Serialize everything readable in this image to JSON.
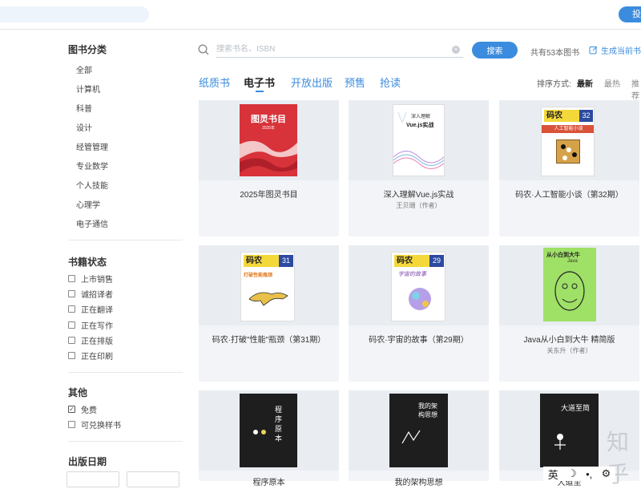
{
  "top": {
    "right_button": "投"
  },
  "sidebar": {
    "category_title": "图书分类",
    "categories": [
      "全部",
      "计算机",
      "科普",
      "设计",
      "经管管理",
      "专业数学",
      "个人技能",
      "心理学",
      "电子通信"
    ],
    "status_title": "书籍状态",
    "statuses": [
      {
        "label": "上市销售",
        "checked": false
      },
      {
        "label": "诚招译者",
        "checked": false
      },
      {
        "label": "正在翻译",
        "checked": false
      },
      {
        "label": "正在写作",
        "checked": false
      },
      {
        "label": "正在排版",
        "checked": false
      },
      {
        "label": "正在印刷",
        "checked": false
      }
    ],
    "other_title": "其他",
    "others": [
      {
        "label": "免费",
        "checked": true
      },
      {
        "label": "可兑换样书",
        "checked": false
      }
    ],
    "date_title": "出版日期"
  },
  "search": {
    "placeholder": "搜索书名、ISBN",
    "button": "搜索",
    "total": "共有53本图书",
    "generate_link": "生成当前书单"
  },
  "tabs": [
    "纸质书",
    "电子书",
    "开放出版",
    "预售",
    "抢读"
  ],
  "active_tab": "电子书",
  "sort": {
    "label": "排序方式:",
    "options": [
      "最新",
      "最热",
      "推荐"
    ],
    "active": "最新"
  },
  "books": [
    {
      "title": "2025年图灵书目",
      "author": "",
      "cover_text": "图灵书目",
      "cover_sub": "2025年"
    },
    {
      "title": "深入理解Vue.js实战",
      "author": "王贝珊（作者）",
      "cover_text": "Vue.js实战",
      "cover_sub": "深入理解"
    },
    {
      "title": "码农·人工智能小谈（第32期）",
      "author": "",
      "cover_text": "码农",
      "cover_num": "32",
      "cover_sub": "人工智能小谈"
    },
    {
      "title": "码农·打破\"性能\"瓶颈（第31期）",
      "author": "",
      "cover_text": "码农",
      "cover_num": "31",
      "cover_sub": "打破性能瓶颈"
    },
    {
      "title": "码农·宇宙的故事（第29期）",
      "author": "",
      "cover_text": "码农",
      "cover_num": "29",
      "cover_sub": "宇宙的故事"
    },
    {
      "title": "Java从小白到大牛 精简版",
      "author": "关东升（作者）",
      "cover_text": "从小白到大牛",
      "cover_sub": "Java"
    },
    {
      "title": "程序原本",
      "author": "",
      "cover_text": "程序原本",
      "cover_sub": ""
    },
    {
      "title": "我的架构思想",
      "author": "",
      "cover_text": "我的架构思想",
      "cover_sub": ""
    },
    {
      "title": "大道至简",
      "author": "",
      "cover_text": "大道至简",
      "cover_sub": ""
    }
  ],
  "partial_titles": [
    "程序原本",
    "我的架构思想",
    "大道至"
  ],
  "watermark": "知乎",
  "ime": [
    "英",
    "☽",
    "•,",
    "⚙"
  ]
}
